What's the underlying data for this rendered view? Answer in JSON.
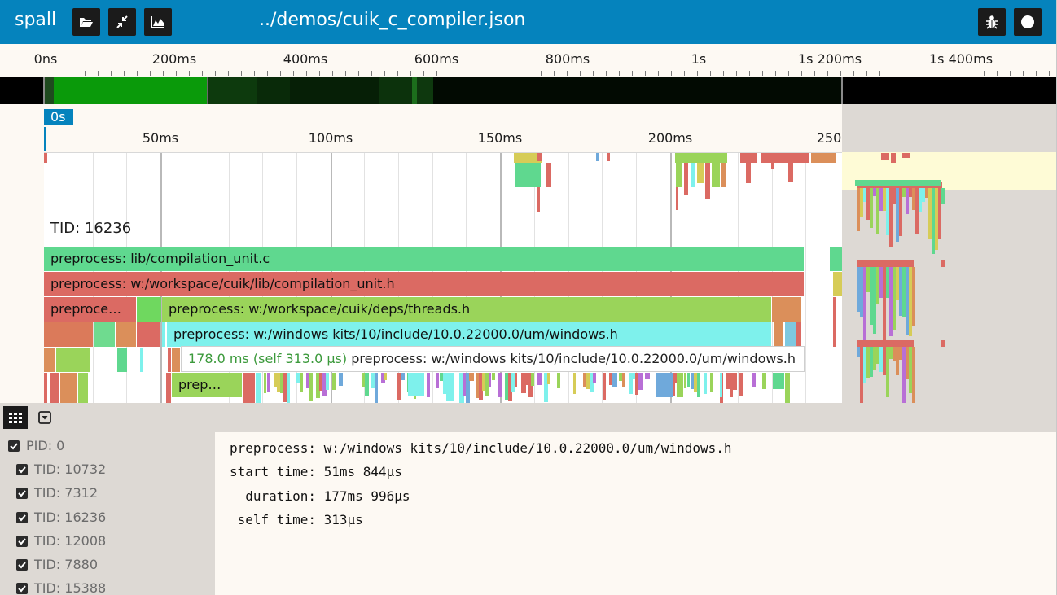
{
  "app": {
    "name": "spall",
    "file_title": "../demos/cuik_c_compiler.json"
  },
  "header_icons": {
    "left": [
      "folder-open-icon",
      "compress-icon",
      "area-chart-icon"
    ],
    "right": [
      "bug-icon",
      "record-circle-icon"
    ]
  },
  "full_ruler": {
    "labels": [
      "0ns",
      "200ms",
      "400ms",
      "600ms",
      "800ms",
      "1s",
      "1s 200ms",
      "1s 400ms"
    ]
  },
  "zoom_ruler": {
    "origin": "0s",
    "labels": [
      "50ms",
      "100ms",
      "150ms",
      "200ms",
      "250"
    ]
  },
  "thread": {
    "label": "TID: 16236"
  },
  "bars": [
    {
      "label": "preprocess: lib/compilation_unit.c",
      "color": "#5fd88f"
    },
    {
      "label": "preprocess: w:/workspace/cuik/lib/compilation_unit.h",
      "color": "#db6a63"
    },
    {
      "label": "preproce…",
      "color": "#db6a63"
    },
    {
      "label": "preprocess: w:/workspace/cuik/deps/threads.h",
      "color": "#9ad45a"
    },
    {
      "label": "preprocess: w:/windows kits/10/include/10.0.22000.0/um/windows.h",
      "color": "#7ef1ec"
    },
    {
      "label": "prep…",
      "color": "#9ad45a"
    }
  ],
  "tooltip": {
    "time": "178.0 ms (self 313.0 µs)",
    "name": "preprocess: w:/windows kits/10/include/10.0.22000.0/um/windows.h"
  },
  "tools": {
    "grid_icon": "grid-icon",
    "dropdown_icon": "dropdown-icon"
  },
  "process_list": [
    {
      "label": "PID: 0",
      "checked": true
    },
    {
      "label": "TID: 10732",
      "checked": true
    },
    {
      "label": "TID: 7312",
      "checked": true
    },
    {
      "label": "TID: 16236",
      "checked": true
    },
    {
      "label": "TID: 12008",
      "checked": true
    },
    {
      "label": "TID: 7880",
      "checked": true
    },
    {
      "label": "TID: 15388",
      "checked": true
    }
  ],
  "details": {
    "name": "preprocess: w:/windows kits/10/include/10.0.22000.0/um/windows.h",
    "start_time": "start time: 51ms 844µs",
    "duration": "  duration: 177ms 996µs",
    "self_time": " self time: 313µs"
  },
  "colors": {
    "accent": "#0583bd",
    "green": "#5fd88f",
    "red": "#db6a63",
    "lime": "#9ad45a",
    "cyan": "#7ef1ec",
    "orange": "#db8f5a"
  }
}
